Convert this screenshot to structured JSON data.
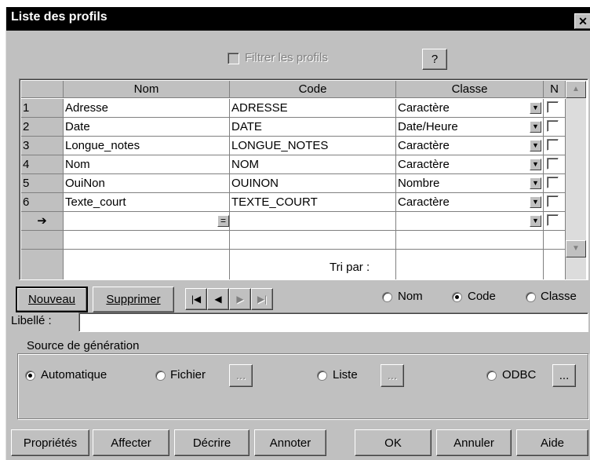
{
  "window": {
    "title": "Liste des profils",
    "close_glyph": "✕"
  },
  "filter": {
    "label": "Filtrer les profils",
    "help_label": "?"
  },
  "table": {
    "headers": [
      "Nom",
      "Code",
      "Classe",
      "N"
    ],
    "rows": [
      {
        "num": "1",
        "nom": "Adresse",
        "code": "ADRESSE",
        "classe": "Caractère"
      },
      {
        "num": "2",
        "nom": "Date",
        "code": "DATE",
        "classe": "Date/Heure"
      },
      {
        "num": "3",
        "nom": "Longue_notes",
        "code": "LONGUE_NOTES",
        "classe": "Caractère"
      },
      {
        "num": "4",
        "nom": "Nom",
        "code": "NOM",
        "classe": "Caractère"
      },
      {
        "num": "5",
        "nom": "OuiNon",
        "code": "OUINON",
        "classe": "Nombre"
      },
      {
        "num": "6",
        "nom": "Texte_court",
        "code": "TEXTE_COURT",
        "classe": "Caractère"
      }
    ],
    "new_row_marker": "➔",
    "equals_button": "="
  },
  "sort": {
    "label": "Tri par :",
    "options": [
      "Nom",
      "Code",
      "Classe"
    ],
    "selected": "Code"
  },
  "nav": {
    "new_label": "Nouveau",
    "delete_label": "Supprimer"
  },
  "libelle": {
    "label": "Libellé :",
    "value": ""
  },
  "source": {
    "title": "Source de génération",
    "options": [
      "Automatique",
      "Fichier",
      "Liste",
      "ODBC"
    ],
    "selected": "Automatique",
    "browse_label": "..."
  },
  "footer": {
    "properties_label": "Propriétés",
    "assign_label": "Affecter",
    "describe_label": "Décrire",
    "annotate_label": "Annoter",
    "ok_label": "OK",
    "cancel_label": "Annuler",
    "help_label": "Aide"
  }
}
